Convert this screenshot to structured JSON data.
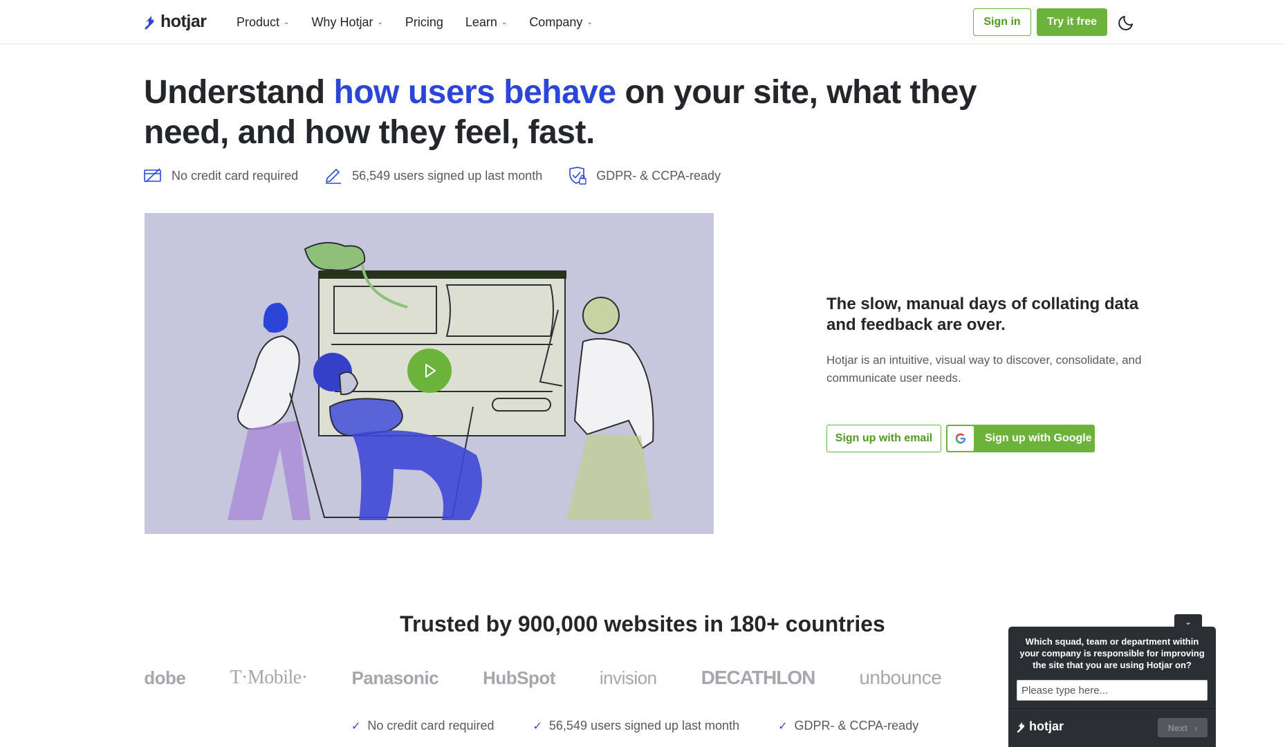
{
  "header": {
    "logo_text": "hotjar",
    "nav": [
      {
        "label": "Product",
        "has_dropdown": true
      },
      {
        "label": "Why Hotjar",
        "has_dropdown": true
      },
      {
        "label": "Pricing",
        "has_dropdown": false
      },
      {
        "label": "Learn",
        "has_dropdown": true
      },
      {
        "label": "Company",
        "has_dropdown": true
      }
    ],
    "signin_label": "Sign in",
    "try_label": "Try it free",
    "theme_icon": "moon-icon"
  },
  "hero": {
    "title_before": "Understand ",
    "title_accent": "how users behave",
    "title_after": " on your site, what they need, and how they feel, fast.",
    "badges": [
      {
        "icon": "credit-card-icon",
        "text": "No credit card required"
      },
      {
        "icon": "pencil-icon",
        "text": "56,549 users signed up last month"
      },
      {
        "icon": "shield-lock-icon",
        "text": "GDPR- & CCPA-ready"
      }
    ],
    "video_play_icon": "play-icon"
  },
  "side": {
    "title": "The slow, manual days of collating data and feedback are over.",
    "text": "Hotjar is an intuitive, visual way to discover, consolidate, and communicate user needs.",
    "email_btn": "Sign up with email",
    "google_btn": "Sign up with Google"
  },
  "trusted": {
    "title": "Trusted by 900,000 websites in 180+ countries",
    "logos": [
      "Adobe",
      "T·Mobile·",
      "Panasonic",
      "HubSpot",
      "invision",
      "DECATHLON",
      "unbounce"
    ],
    "checks": [
      "No credit card required",
      "56,549 users signed up last month",
      "GDPR- & CCPA-ready"
    ]
  },
  "widget": {
    "question": "Which squad, team or department within your company is responsible for improving the site that you are using Hotjar on?",
    "placeholder": "Please type here...",
    "logo_text": "hotjar",
    "next_label": "Next"
  },
  "colors": {
    "accent_blue": "#2b45d8",
    "brand_green": "#6bb33b",
    "video_bg": "#c6c6dc",
    "widget_bg": "#2b2e33"
  }
}
